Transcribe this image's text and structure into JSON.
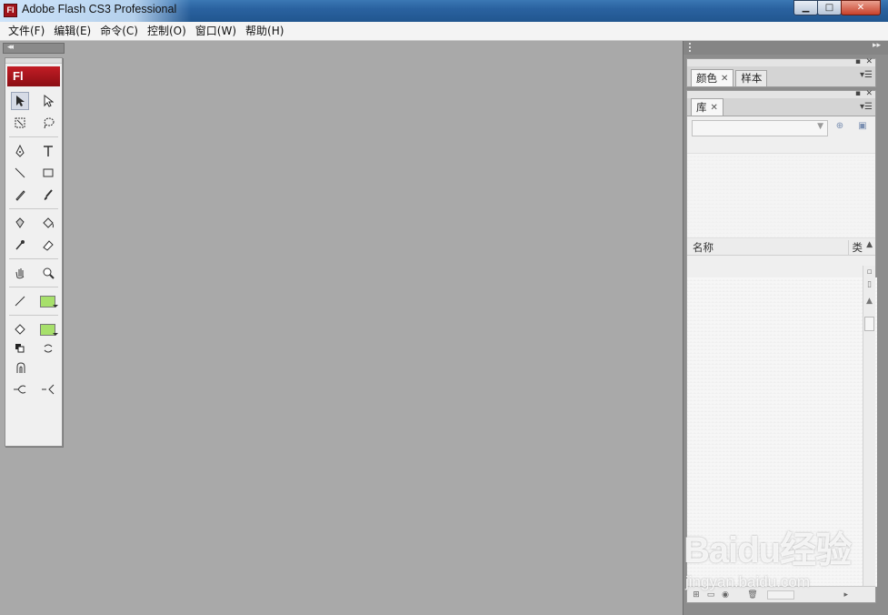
{
  "window": {
    "app_icon": "Fl",
    "title": "Adobe Flash CS3 Professional",
    "minimize_icon": "minimize-icon",
    "maximize_icon": "maximize-icon",
    "close_icon": "close-icon"
  },
  "menubar": {
    "items": [
      "文件(F)",
      "编辑(E)",
      "命令(C)",
      "控制(O)",
      "窗口(W)",
      "帮助(H)"
    ]
  },
  "tools": {
    "collapse_arrows": "◂◂",
    "logo": "Fl",
    "icons": [
      "selection-tool-icon",
      "subselection-tool-icon",
      "free-transform-tool-icon",
      "lasso-tool-icon",
      "pen-tool-icon",
      "text-tool-icon",
      "line-tool-icon",
      "rectangle-tool-icon",
      "pencil-tool-icon",
      "brush-tool-icon",
      "ink-bottle-tool-icon",
      "paint-bucket-tool-icon",
      "eyedropper-tool-icon",
      "eraser-tool-icon",
      "hand-tool-icon",
      "zoom-tool-icon",
      "stroke-color-icon",
      "fill-color-icon",
      "black-white-icon",
      "swap-colors-icon",
      "snap-magnet-icon",
      "smooth-icon",
      "straighten-icon"
    ],
    "stroke_color": "#a7e06b",
    "fill_color": "#a7e06b"
  },
  "dock": {
    "expand_arrows": "▸▸",
    "color_panel": {
      "tabs": [
        "颜色",
        "样本"
      ]
    },
    "library_panel": {
      "tab": "库",
      "columns": {
        "name": "名称",
        "type": "类"
      }
    }
  },
  "watermark": {
    "logo": "Baidu经验",
    "url": "jingyan.baidu.com"
  }
}
